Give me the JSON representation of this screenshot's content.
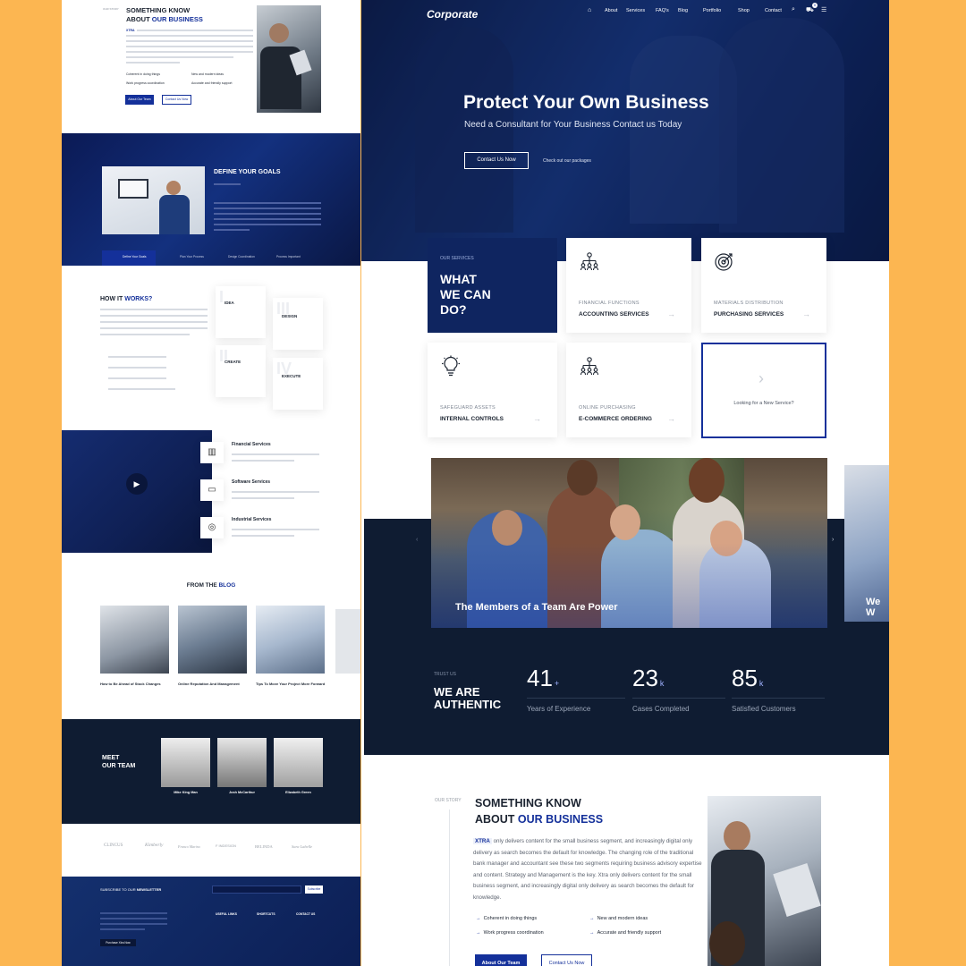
{
  "colors": {
    "background": "#fcb651",
    "navy": "#0f1c32",
    "brand_blue": "#14309a"
  },
  "left": {
    "about": {
      "label": "OUR STORY",
      "title1": "SOMETHING KNOW",
      "title2_prefix": "ABOUT ",
      "title2_accent": "OUR BUSINESS",
      "badge": "XTRA",
      "features": [
        "Coherent in doing things",
        "New and modern ideas",
        "Work progress coordination",
        "Accurate and friendly support"
      ],
      "btn_primary": "About Our Team",
      "btn_secondary": "Contact Us Now"
    },
    "goals": {
      "title": "DEFINE YOUR GOALS",
      "tabs": [
        "Define Your Goals",
        "Plan Your Process",
        "Design Coordination",
        "Process Important"
      ]
    },
    "how": {
      "title_prefix": "HOW IT ",
      "title_accent": "WORKS?",
      "steps": [
        {
          "num": "01.",
          "label": "IDEA",
          "roman": "I"
        },
        {
          "num": "02.",
          "label": "CREATE",
          "roman": "II"
        },
        {
          "num": "03.",
          "label": "DESIGN",
          "roman": "III"
        },
        {
          "num": "04.",
          "label": "EXECUTE",
          "roman": "IV"
        }
      ]
    },
    "services": [
      {
        "title": "Financial Services",
        "icon": "chart-icon"
      },
      {
        "title": "Software Services",
        "icon": "monitor-icon"
      },
      {
        "title": "Industrial Services",
        "icon": "target-icon"
      }
    ],
    "blog": {
      "title_prefix": "FROM THE ",
      "title_accent": "BLOG",
      "posts": [
        "How to Be Ahead of Stock Changes",
        "Online Reputation And Management",
        "Tips To Move Your Project More Forward"
      ]
    },
    "team": {
      "title1": "MEET",
      "title2": "OUR TEAM",
      "members": [
        {
          "name": "Mike King Man"
        },
        {
          "name": "Josh McCarthur"
        },
        {
          "name": "Elizabeth Green"
        }
      ]
    },
    "logos": [
      "CLINCUS",
      "Kimberly",
      "Franco Marino",
      "F INDESIGN",
      "BELINDA",
      "Sara Labelle"
    ],
    "newsletter": {
      "label_prefix": "SUBSCRIBE TO OUR ",
      "label_accent": "NEWSLETTER",
      "button": "Subscribe",
      "cta": "Purchase Xtra Now",
      "cols": [
        "USEFUL LINKS",
        "SHORTCUTS",
        "CONTACT US"
      ]
    }
  },
  "header": {
    "logo": "Corporate",
    "nav": [
      "About",
      "Services",
      "FAQ's",
      "Blog",
      "Portfolio",
      "Shop",
      "Contact"
    ],
    "cart_count": "0"
  },
  "hero": {
    "title": "Protect Your Own Business",
    "subtitle": "Need a Consultant for Your Business Contact us Today",
    "btn": "Contact Us Now",
    "link": "Check out our packages"
  },
  "services": {
    "label": "OUR SERVICES",
    "title": [
      "WHAT",
      "WE CAN",
      "DO?"
    ],
    "cards": [
      {
        "cat": "FINANCIAL FUNCTIONS",
        "title": "ACCOUNTING SERVICES",
        "icon": "people-network-icon"
      },
      {
        "cat": "MATERIALS DISTRIBUTION",
        "title": "PURCHASING SERVICES",
        "icon": "target-icon"
      },
      {
        "cat": "SAFEGUARD ASSETS",
        "title": "INTERNAL CONTROLS",
        "icon": "lightbulb-icon"
      },
      {
        "cat": "ONLINE PURCHASING",
        "title": "E-COMMERCE ORDERING",
        "icon": "people-network-icon"
      }
    ],
    "cta": "Looking for a New Service?"
  },
  "team_banner": {
    "caption": "The Members of a Team Are Power",
    "peek_caption": "We W"
  },
  "stats": {
    "label": "TRUST US",
    "title": [
      "WE ARE",
      "AUTHENTIC"
    ],
    "items": [
      {
        "num": "41",
        "sup": "+",
        "label": "Years of Experience"
      },
      {
        "num": "23",
        "sup": "k",
        "label": "Cases Completed"
      },
      {
        "num": "85",
        "sup": "k",
        "label": "Satisfied Customers"
      }
    ]
  },
  "about": {
    "label": "OUR STORY",
    "title1": "SOMETHING KNOW",
    "title2_prefix": "ABOUT ",
    "title2_accent": "OUR BUSINESS",
    "badge": "XTRA",
    "body": " only delivers content for the small business segment, and increasingly digital only delivery as search becomes the default for knowledge. The changing role of the traditional bank manager and accountant see these two segments requiring business advisory expertise and content. Strategy and Management is the key. Xtra only delivers content for the small business segment, and increasingly digital only delivery as search becomes the default for knowledge.",
    "features": [
      "Coherent in doing things",
      "New and modern ideas",
      "Work progress coordination",
      "Accurate and friendly support"
    ],
    "btn_primary": "About Our Team",
    "btn_secondary": "Contact Us Now"
  }
}
